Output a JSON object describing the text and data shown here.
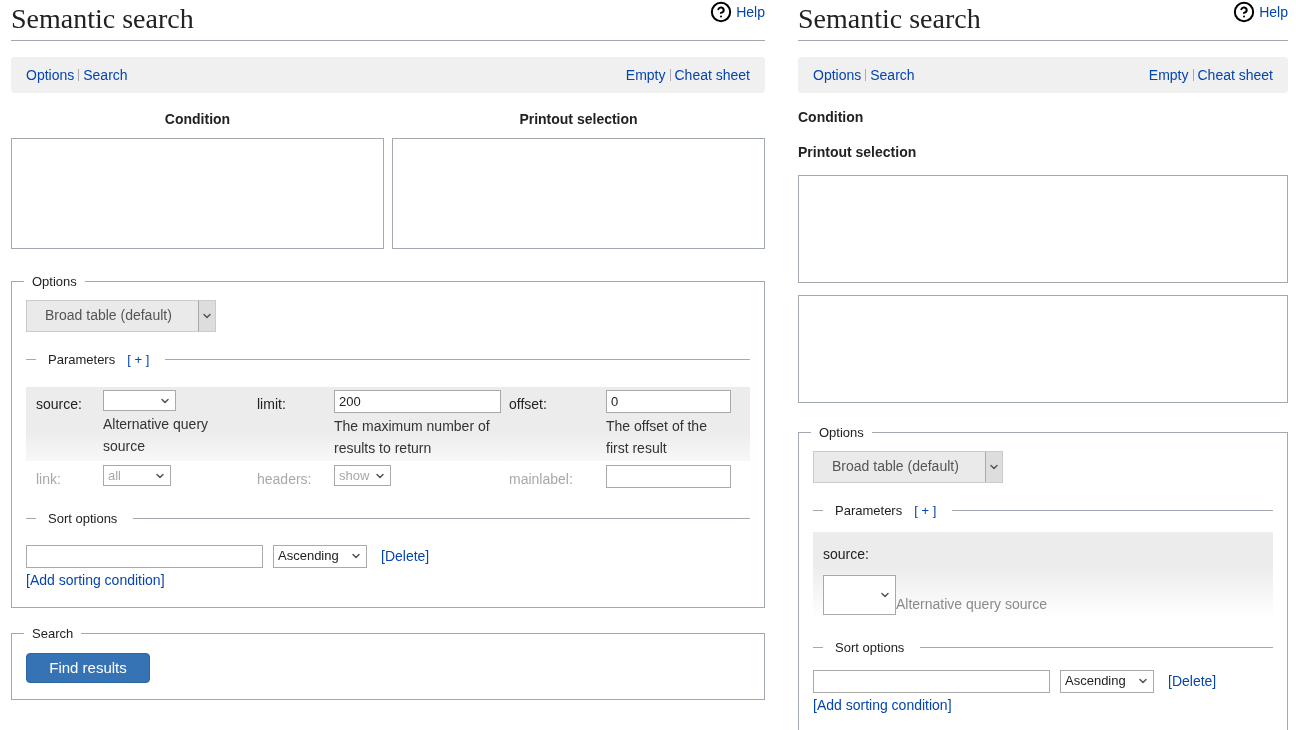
{
  "panels": [
    {
      "kind": "wide",
      "title": "Semantic search",
      "help": "Help",
      "toolbar": {
        "left": [
          "Options",
          "Search"
        ],
        "right": [
          "Empty",
          "Cheat sheet"
        ]
      },
      "condition_label": "Condition",
      "printout_label": "Printout selection",
      "options": {
        "legend": "Options",
        "format": "Broad table (default)",
        "parameters_legend": "Parameters",
        "parameters_toggle": "[ + ]",
        "params": [
          {
            "label": "source:",
            "kind": "select",
            "description": "Alternative query source"
          },
          {
            "label": "limit:",
            "kind": "input",
            "value": "200",
            "description": "The maximum number of results to return"
          },
          {
            "label": "offset:",
            "kind": "input",
            "value": "0",
            "description": "The offset of the first result"
          }
        ],
        "faded_params": [
          {
            "label": "link:",
            "kind": "select",
            "value": "all"
          },
          {
            "label": "headers:",
            "kind": "select",
            "value": "show"
          },
          {
            "label": "mainlabel:",
            "kind": "input"
          }
        ]
      },
      "sort": {
        "legend": "Sort options",
        "order": "Ascending",
        "delete": "[Delete]",
        "add": "[Add sorting condition]"
      },
      "search": {
        "legend": "Search",
        "button": "Find results"
      }
    },
    {
      "kind": "narrow",
      "title": "Semantic search",
      "help": "Help",
      "toolbar": {
        "left": [
          "Options",
          "Search"
        ],
        "right": [
          "Empty",
          "Cheat sheet"
        ]
      },
      "condition_label": "Condition",
      "printout_label": "Printout selection",
      "options": {
        "legend": "Options",
        "format": "Broad table (default)",
        "parameters_legend": "Parameters",
        "parameters_toggle": "[ + ]",
        "params": [
          {
            "label": "source:",
            "kind": "select",
            "description": "Alternative query source"
          }
        ]
      },
      "sort": {
        "legend": "Sort options",
        "order": "Ascending",
        "delete": "[Delete]",
        "add": "[Add sorting condition]"
      }
    }
  ]
}
